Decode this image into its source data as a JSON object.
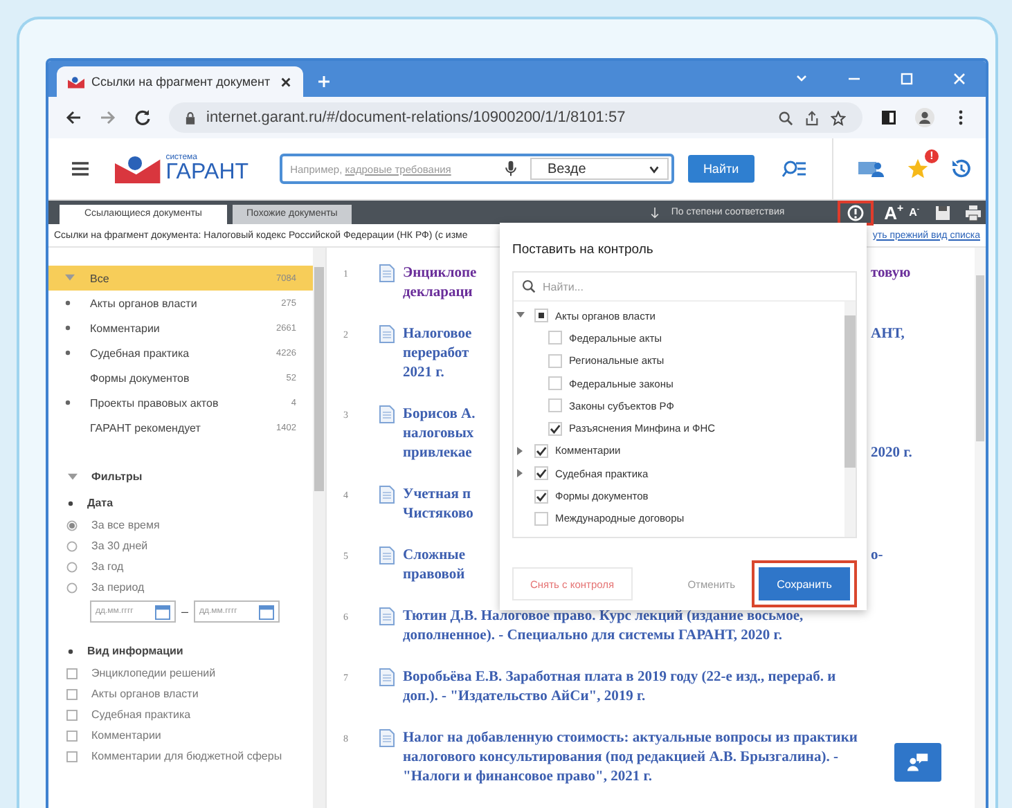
{
  "browser": {
    "tab_title": "Ссылки на фрагмент документ",
    "url": "internet.garant.ru/#/document-relations/10900200/1/1/8101:57"
  },
  "header": {
    "logo_small": "система",
    "logo": "ГАРАНТ",
    "hint": "Например, ",
    "hint_example": "кадровые требования",
    "scope": "Везде",
    "search_button": "Найти",
    "badge": "!"
  },
  "tabs": [
    {
      "label": "Ссылающиеся документы",
      "selected": true
    },
    {
      "label": "Похожие документы",
      "selected": false
    }
  ],
  "toolbar": {
    "sort": "По степени соответствия",
    "info_highlighted": true,
    "font_larger": "A$^{+}$",
    "font_smaller": "A$^{-}$"
  },
  "info_line": {
    "text": "Ссылки на фрагмент документа: Налоговый кодекс Российской Федерации (НК РФ) (с изме",
    "link": "уть прежний вид списка"
  },
  "categories": [
    {
      "label": "Все",
      "count": "7084",
      "expandable": true,
      "expanded": true,
      "selected": true
    },
    {
      "label": "Акты органов власти",
      "count": "275",
      "expandable": true,
      "expanded": false,
      "selected": false
    },
    {
      "label": "Комментарии",
      "count": "2661",
      "expandable": true,
      "expanded": false,
      "selected": false
    },
    {
      "label": "Судебная практика",
      "count": "4226",
      "expandable": true,
      "expanded": false,
      "selected": false
    },
    {
      "label": "Формы документов",
      "count": "52",
      "expandable": false,
      "selected": false
    },
    {
      "label": "Проекты правовых актов",
      "count": "4",
      "expandable": true,
      "expanded": false,
      "selected": false
    },
    {
      "label": "ГАРАНТ рекомендует",
      "count": "1402",
      "expandable": false,
      "selected": false
    }
  ],
  "filters": {
    "title": "Фильтры",
    "date": {
      "title": "Дата",
      "options": [
        {
          "label": "За все время",
          "selected": true
        },
        {
          "label": "За 30 дней",
          "selected": false
        },
        {
          "label": "За год",
          "selected": false
        },
        {
          "label": "За период",
          "selected": false
        }
      ],
      "from_placeholder": "дд.мм.гггг",
      "separator": "–",
      "to_placeholder": "дд.мм.гггг"
    },
    "info_types": {
      "title": "Вид информации",
      "options": [
        {
          "label": "Энциклопедии решений",
          "checked": false
        },
        {
          "label": "Акты органов власти",
          "checked": false
        },
        {
          "label": "Судебная практика",
          "checked": false
        },
        {
          "label": "Комментарии",
          "checked": false
        },
        {
          "label": "Комментарии для бюджетной сферы",
          "checked": false
        }
      ]
    }
  },
  "documents": [
    {
      "number": "1",
      "visited": true,
      "lines": [
        {
          "text": "Энциклопе",
          "tail": "товую"
        },
        {
          "text": "деклараци"
        }
      ]
    },
    {
      "number": "2",
      "visited": false,
      "lines": [
        {
          "text": "Налоговое",
          "tail": "АНТ,"
        },
        {
          "text": "переработ"
        },
        {
          "text": "2021 г."
        }
      ]
    },
    {
      "number": "3",
      "visited": false,
      "lines": [
        {
          "text": "Борисов А."
        },
        {
          "text": "налоговых"
        },
        {
          "text": "привлекае",
          "tail": "2020 г."
        }
      ]
    },
    {
      "number": "4",
      "visited": false,
      "lines": [
        {
          "text": "Учетная п"
        },
        {
          "text": "Чистяково"
        }
      ]
    },
    {
      "number": "5",
      "visited": false,
      "lines": [
        {
          "text": "Сложные",
          "tail": "о-"
        },
        {
          "text": "правовой"
        }
      ]
    },
    {
      "number": "6",
      "visited": false,
      "lines": [
        {
          "text": "Тютин Д.В. Налоговое право. Курс лекций (издание восьмое,"
        },
        {
          "text": "дополненное). - Специально для системы ГАРАНТ, 2020 г."
        }
      ]
    },
    {
      "number": "7",
      "visited": false,
      "lines": [
        {
          "text": "Воробьёва Е.В. Заработная плата в 2019 году (22-е изд., перераб. и"
        },
        {
          "text": "доп.). - \"Издательство АйСи\", 2019 г."
        }
      ]
    },
    {
      "number": "8",
      "visited": false,
      "lines": [
        {
          "text": "Налог на добавленную стоимость: актуальные вопросы из практики"
        },
        {
          "text": "налогового консультирования (под редакцией А.В. Брызгалина). -"
        },
        {
          "text": "\"Налоги и финансовое право\", 2021 г."
        }
      ]
    }
  ],
  "dialog": {
    "title": "Поставить на контроль",
    "search_placeholder": "Найти...",
    "tree": [
      {
        "label": "Акты органов власти",
        "expandable": true,
        "expanded": true,
        "checked": false,
        "partial": true,
        "children": [
          {
            "label": "Федеральные акты",
            "checked": false
          },
          {
            "label": "Региональные акты",
            "checked": false
          },
          {
            "label": "Федеральные законы",
            "checked": false
          },
          {
            "label": "Законы субъектов РФ",
            "checked": false
          },
          {
            "label": "Разъяснения Минфина и ФНС",
            "checked": true
          }
        ]
      },
      {
        "label": "Комментарии",
        "expandable": true,
        "expanded": false,
        "checked": true
      },
      {
        "label": "Судебная практика",
        "expandable": true,
        "expanded": false,
        "checked": true
      },
      {
        "label": "Формы документов",
        "expandable": false,
        "checked": true
      },
      {
        "label": "Международные договоры",
        "expandable": false,
        "checked": false,
        "partial": false
      }
    ],
    "remove_button": "Снять с контроля",
    "cancel_button": "Отменить",
    "save_button": "Сохранить",
    "save_highlighted": true
  }
}
